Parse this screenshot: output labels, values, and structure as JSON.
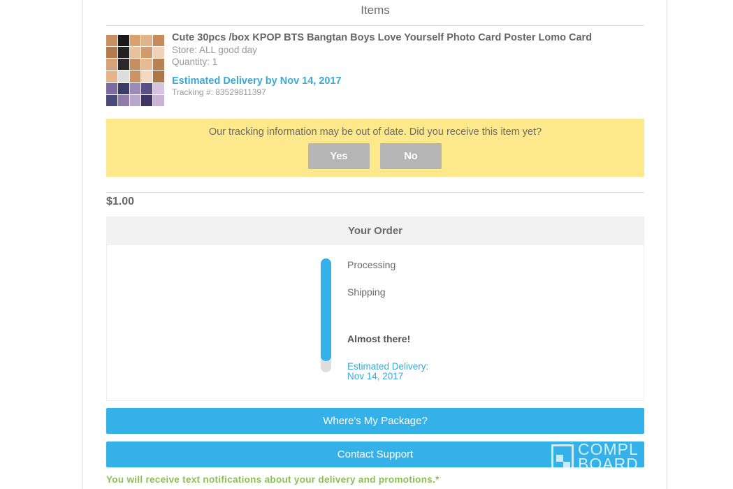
{
  "section_title": "Items",
  "item": {
    "title": "Cute 30pcs /box KPOP BTS Bangtan Boys Love Yourself Photo Card Poster Lomo Card",
    "store": "Store: ALL good day",
    "quantity": "Quantity: 1",
    "estimated_delivery": "Estimated Delivery by Nov 14, 2017",
    "tracking": "Tracking #: 83529811397"
  },
  "alert": {
    "message": "Our tracking information may be out of date. Did you receive this item yet?",
    "yes_label": "Yes",
    "no_label": "No"
  },
  "price": "$1.00",
  "order": {
    "header": "Your Order",
    "progress": 0.9,
    "steps": {
      "processing": "Processing",
      "shipping": "Shipping",
      "almost": "Almost there!",
      "estimated_label": "Estimated Delivery:",
      "estimated_date": "Nov 14, 2017"
    }
  },
  "buttons": {
    "package": "Where's My Package?",
    "support": "Contact Support"
  },
  "watermark": "COMPL\nBOARD",
  "notice": "You will receive text notifications about your delivery and promotions.*",
  "colors": {
    "accent_blue": "#33b1e8",
    "alert_yellow": "#fde98c",
    "notice_green": "#8cbf55"
  }
}
